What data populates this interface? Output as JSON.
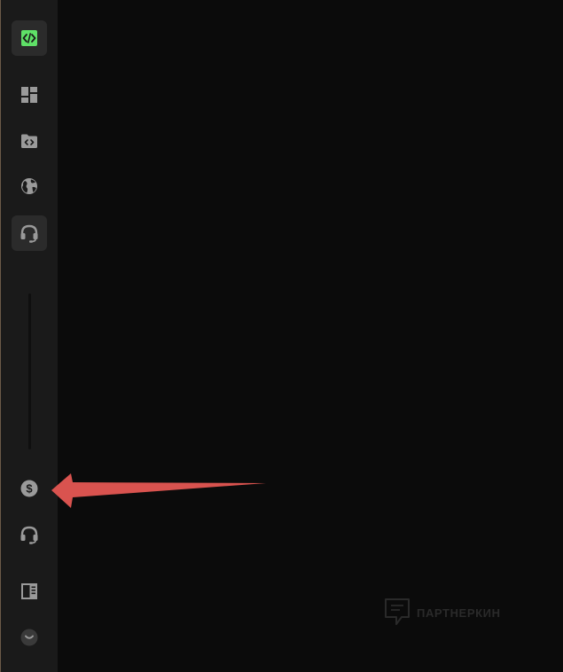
{
  "sidebar": {
    "items": [
      {
        "name": "code-icon",
        "active": true
      },
      {
        "name": "dashboard-icon",
        "active": false
      },
      {
        "name": "code-folder-icon",
        "active": false
      },
      {
        "name": "globe-icon",
        "active": false
      },
      {
        "name": "headset-icon",
        "active": true
      }
    ],
    "bottom_items": [
      {
        "name": "dollar-icon"
      },
      {
        "name": "headset-icon"
      },
      {
        "name": "book-icon"
      },
      {
        "name": "chevron-down-circle-icon"
      }
    ]
  },
  "annotation": {
    "arrow_color": "#d9534f",
    "points_to": "dollar-icon"
  },
  "watermark": {
    "text": "ПАРТНЕРКИН"
  },
  "colors": {
    "sidebar_bg": "#1a1a1a",
    "main_bg": "#0b0b0b",
    "active_bg": "#2b2b2b",
    "icon": "#9a9a9a",
    "code_accent": "#5fe067"
  }
}
